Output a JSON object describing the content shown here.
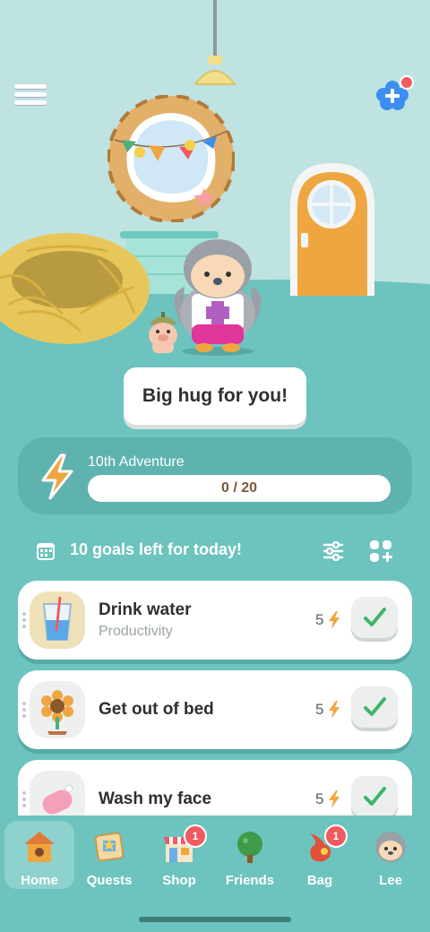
{
  "scene": {
    "speech_bubble": "Big hug for you!"
  },
  "adventure": {
    "label": "10th Adventure",
    "progress_text": "0 / 20",
    "progress_value": 0,
    "progress_max": 20
  },
  "goals_header": {
    "text": "10 goals left for today!"
  },
  "goals": [
    {
      "title": "Drink water",
      "category": "Productivity",
      "points": "5",
      "icon": "water-glass-icon"
    },
    {
      "title": "Get out of bed",
      "category": "",
      "points": "5",
      "icon": "sunflower-icon"
    },
    {
      "title": "Wash my face",
      "category": "",
      "points": "5",
      "icon": "soap-icon"
    }
  ],
  "nav": {
    "items": [
      {
        "label": "Home",
        "icon": "birdhouse-icon",
        "active": true
      },
      {
        "label": "Quests",
        "icon": "quest-map-icon"
      },
      {
        "label": "Shop",
        "icon": "shop-icon",
        "badge": "1"
      },
      {
        "label": "Friends",
        "icon": "tree-icon"
      },
      {
        "label": "Bag",
        "icon": "bag-icon",
        "badge": "1"
      },
      {
        "label": "Lee",
        "icon": "avatar-icon"
      }
    ]
  },
  "colors": {
    "background": "#6dc3bd",
    "wall": "#bfe3e0",
    "accent_orange": "#f0a640",
    "check_green": "#3cb56a",
    "badge_red": "#f05a60"
  }
}
